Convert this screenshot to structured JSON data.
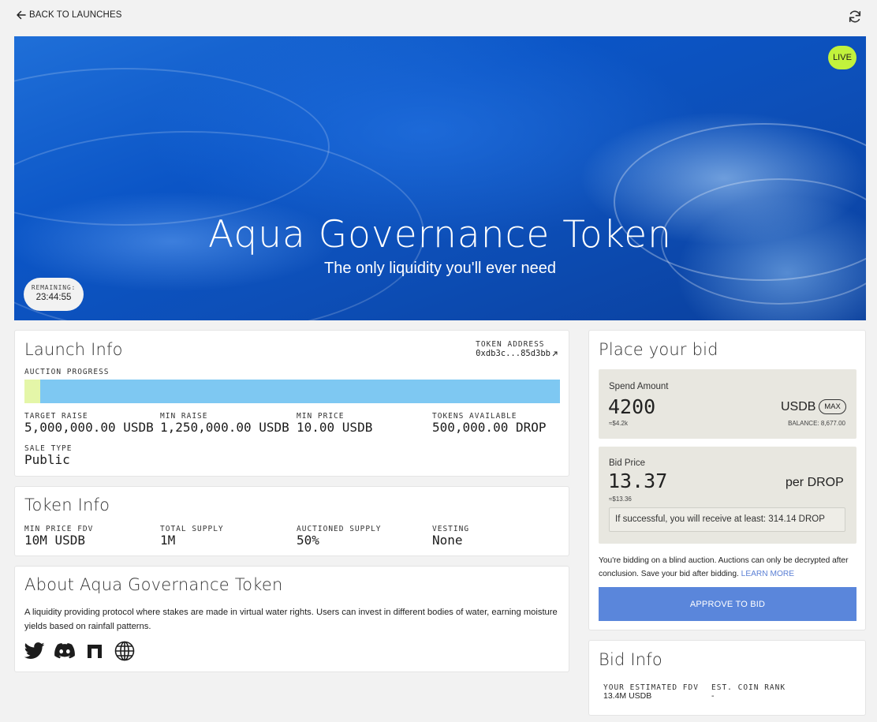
{
  "nav": {
    "back_label": "BACK TO LAUNCHES"
  },
  "hero": {
    "status": "LIVE",
    "title": "Aqua Governance Token",
    "subtitle": "The only liquidity you'll ever need",
    "remaining_label": "REMAINING:",
    "remaining_value": "23:44:55"
  },
  "launch_info": {
    "title": "Launch Info",
    "token_address_label": "TOKEN ADDRESS",
    "token_address": "0xdb3c...85d3bb",
    "progress_label": "AUCTION PROGRESS",
    "progress_fraction": 0.03,
    "stats": [
      {
        "label": "TARGET RAISE",
        "value": "5,000,000.00 USDB"
      },
      {
        "label": "MIN RAISE",
        "value": "1,250,000.00 USDB"
      },
      {
        "label": "MIN PRICE",
        "value": "10.00 USDB"
      },
      {
        "label": "TOKENS AVAILABLE",
        "value": "500,000.00 DROP"
      }
    ],
    "sale_type_label": "SALE TYPE",
    "sale_type": "Public"
  },
  "token_info": {
    "title": "Token Info",
    "stats": [
      {
        "label": "MIN PRICE FDV",
        "value": "10M USDB"
      },
      {
        "label": "TOTAL SUPPLY",
        "value": "1M"
      },
      {
        "label": "AUCTIONED SUPPLY",
        "value": "50%"
      },
      {
        "label": "VESTING",
        "value": "None"
      }
    ]
  },
  "about": {
    "title": "About Aqua Governance Token",
    "text": "A liquidity providing protocol where stakes are made in virtual water rights. Users can invest in different bodies of water, earning moisture yields based on rainfall patterns.",
    "socials": [
      "twitter-icon",
      "discord-icon",
      "gitbook-icon",
      "globe-icon"
    ]
  },
  "bid": {
    "title": "Place your bid",
    "spend_label": "Spend Amount",
    "spend_value": "4200",
    "spend_approx": "≈$4.2k",
    "spend_unit": "USDB",
    "max_label": "MAX",
    "balance": "BALANCE: 8,677.00",
    "price_label": "Bid Price",
    "price_value": "13.37",
    "price_approx": "≈$13.36",
    "price_unit": "per DROP",
    "receive_text": "If successful, you will receive at least: 314.14 DROP",
    "note": "You're bidding on a blind auction. Auctions can only be decrypted after conclusion. Save your bid after bidding.",
    "learn_more": "LEARN MORE",
    "approve_label": "APPROVE TO BID"
  },
  "bid_info": {
    "title": "Bid Info",
    "fdv_label": "YOUR ESTIMATED FDV",
    "fdv_value": "13.4M USDB",
    "rank_label": "EST. COIN RANK",
    "rank_value": "-"
  },
  "colors": {
    "accent_button": "#5a86db",
    "live_badge": "#c2f23c",
    "progress_track": "#7ec8f2",
    "progress_fill": "#e4f6a8"
  }
}
